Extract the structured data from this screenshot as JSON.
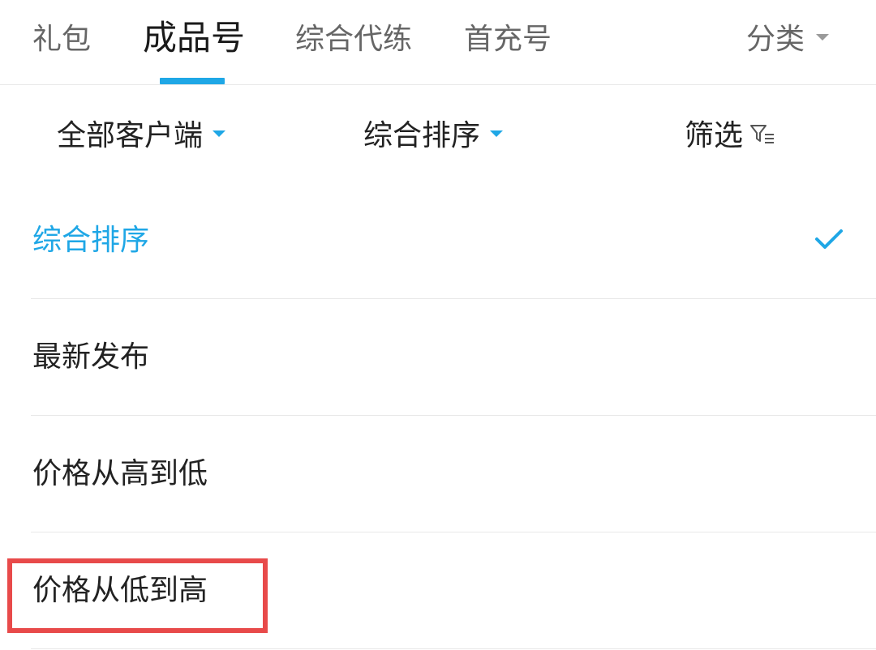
{
  "tabs": [
    {
      "label": "礼包",
      "active": false
    },
    {
      "label": "成品号",
      "active": true
    },
    {
      "label": "综合代练",
      "active": false
    },
    {
      "label": "首充号",
      "active": false
    }
  ],
  "category": {
    "label": "分类"
  },
  "filters": {
    "client": "全部客户端",
    "sort": "综合排序",
    "screen": "筛选"
  },
  "sort_options": [
    {
      "label": "综合排序",
      "selected": true
    },
    {
      "label": "最新发布",
      "selected": false
    },
    {
      "label": "价格从高到低",
      "selected": false
    },
    {
      "label": "价格从低到高",
      "selected": false
    }
  ],
  "colors": {
    "accent": "#1fa7e6",
    "highlight": "#e84a4a",
    "text_primary": "#222222",
    "text_secondary": "#666666",
    "divider": "#e8e8e8"
  }
}
